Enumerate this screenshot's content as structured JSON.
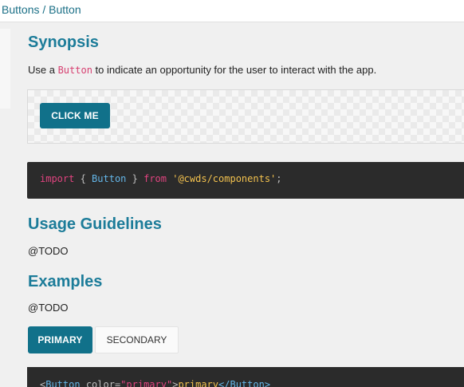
{
  "breadcrumb": {
    "text": "Buttons / Button"
  },
  "synopsis": {
    "heading": "Synopsis",
    "text_before": "Use a ",
    "inline_code": "Button",
    "text_after": " to indicate an opportunity for the user to interact with the app."
  },
  "demo": {
    "button_label": "CLICK ME"
  },
  "code_import": {
    "kw_import": "import",
    "open_brace": " { ",
    "ident": "Button",
    "close_brace": " } ",
    "kw_from": "from",
    "space": " ",
    "module": "'@cwds/components'",
    "semicolon": ";"
  },
  "usage": {
    "heading": "Usage Guidelines",
    "text": "@TODO"
  },
  "examples": {
    "heading": "Examples",
    "text": "@TODO",
    "tabs": [
      {
        "label": "PRIMARY",
        "active": true
      },
      {
        "label": "SECONDARY",
        "active": false
      }
    ]
  },
  "code_example": {
    "open": "<",
    "tag": "Button",
    "attr": " color=",
    "value": "\"primary\"",
    "gt": ">",
    "text": "primary",
    "close_tag": "</Button>"
  },
  "colors": {
    "accent": "#1c7c99",
    "button": "#11718a",
    "code_bg": "#2b2b2b",
    "code_keyword": "#e0437f",
    "code_string": "#f2c14e",
    "code_ident": "#64b6e8"
  }
}
